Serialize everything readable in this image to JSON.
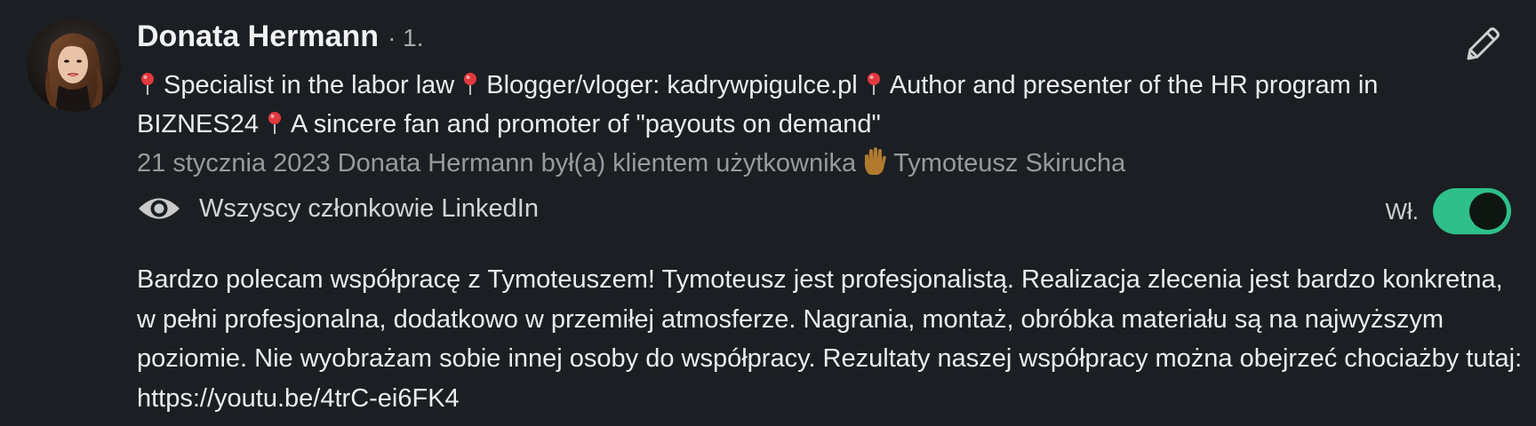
{
  "recommendation": {
    "name": "Donata Hermann",
    "degree": "· 1.",
    "headline_parts": [
      "Specialist in the labor law",
      "Blogger/vloger: kadrywpigulce.pl",
      "Author and presenter of the HR program in BIZNES24",
      "A sincere fan and promoter of \"payouts on demand\""
    ],
    "meta_prefix": "21 stycznia 2023 Donata Hermann był(a) klientem użytkownika",
    "meta_suffix": "Tymoteusz Skirucha",
    "visibility_label": "Wszyscy członkowie LinkedIn",
    "toggle_label": "Wł.",
    "toggle_on": true,
    "body": "Bardzo polecam współpracę z Tymoteuszem! Tymoteusz jest profesjonalistą. Realizacja zlecenia jest bardzo konkretna, w pełni profesjonalna, dodatkowo w przemiłej atmosferze. Nagrania, montaż, obróbka materiału są na najwyższym poziomie. Nie wyobrażam sobie innej osoby do współpracy. Rezultaty naszej współpracy można obejrzeć chociażby tutaj: https://youtu.be/4trC-ei6FK4"
  },
  "colors": {
    "background": "#1b1f23",
    "toggle_on": "#2fbf8a",
    "pin": "#e0393e"
  },
  "icons": {
    "pin": "round-pushpin-icon",
    "hand": "raised-hand-icon",
    "eye": "eye-icon",
    "edit": "pencil-icon"
  }
}
